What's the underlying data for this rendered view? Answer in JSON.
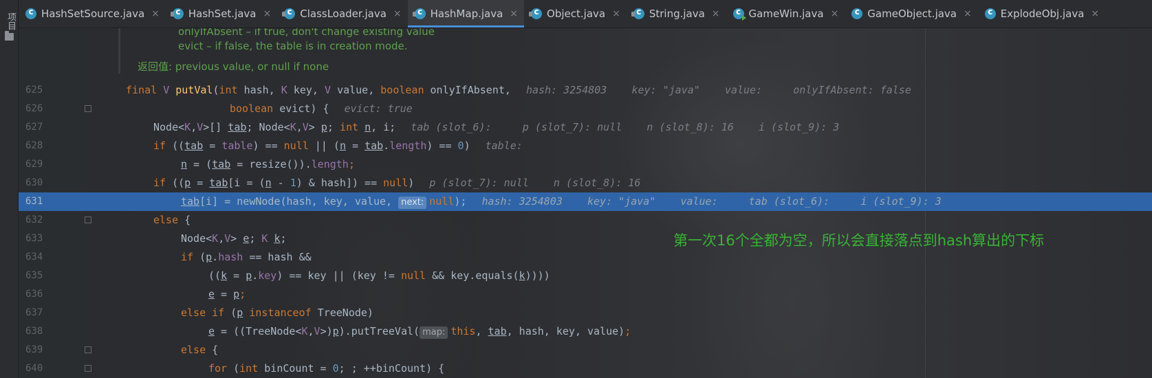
{
  "sidebar": {
    "label": "项目"
  },
  "tabs": [
    {
      "label": "HashSetSource.java",
      "icon": "class-icon"
    },
    {
      "label": "HashSet.java",
      "icon": "class-locked-icon"
    },
    {
      "label": "ClassLoader.java",
      "icon": "class-locked-icon"
    },
    {
      "label": "HashMap.java",
      "icon": "class-locked-icon",
      "active": true
    },
    {
      "label": "Object.java",
      "icon": "class-locked-icon"
    },
    {
      "label": "String.java",
      "icon": "class-locked-icon"
    },
    {
      "label": "GameWin.java",
      "icon": "class-runnable-icon"
    },
    {
      "label": "GameObject.java",
      "icon": "class-icon"
    },
    {
      "label": "ExplodeObj.java",
      "icon": "class-icon"
    }
  ],
  "close_glyph": "×",
  "javadoc": {
    "line1": "onlyIfAbsent – if true, don't change existing value",
    "line2": "evict – if false, the table is in creation mode.",
    "returns_label": "返回值: ",
    "returns_text": "previous value, or null if none"
  },
  "lines": {
    "l625": {
      "num": "625",
      "inline": "hash: 3254803    key: \"java\"    value:     onlyIfAbsent: false"
    },
    "l626": {
      "num": "626",
      "inline": "evict: true"
    },
    "l627": {
      "num": "627",
      "inline": "tab (slot_6):     p (slot_7): null    n (slot_8): 16    i (slot_9): 3"
    },
    "l628": {
      "num": "628",
      "inline": "table:"
    },
    "l629": {
      "num": "629"
    },
    "l630": {
      "num": "630",
      "inline": "p (slot_7): null    n (slot_8): 16"
    },
    "l631": {
      "num": "631",
      "hint": "next:",
      "inline": "hash: 3254803    key: \"java\"    value:     tab (slot_6):     i (slot_9): 3"
    },
    "l632": {
      "num": "632"
    },
    "l633": {
      "num": "633"
    },
    "l634": {
      "num": "634"
    },
    "l635": {
      "num": "635"
    },
    "l636": {
      "num": "636"
    },
    "l637": {
      "num": "637"
    },
    "l638": {
      "num": "638",
      "hint": "map:"
    },
    "l639": {
      "num": "639"
    },
    "l640": {
      "num": "640"
    }
  },
  "annotation": "第一次16个全都为空，所以会直接落点到hash算出的下标",
  "colors": {
    "highlight": "#2f65a8",
    "keyword": "#cc7832",
    "annotation": "#38b335",
    "doc": "#5fa04e",
    "active_tab_underline": "#4a8fd8"
  }
}
